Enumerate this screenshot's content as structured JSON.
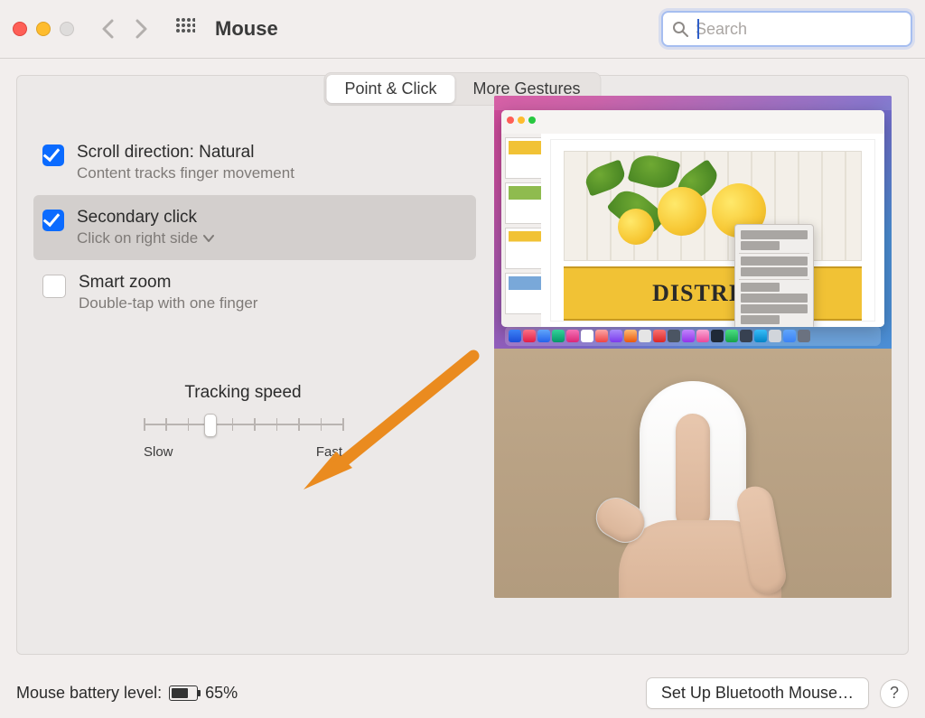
{
  "window": {
    "title": "Mouse",
    "search_placeholder": "Search"
  },
  "tabs": {
    "point_click": "Point & Click",
    "more_gestures": "More Gestures",
    "active": "point_click"
  },
  "options": {
    "scroll": {
      "title": "Scroll direction: Natural",
      "subtitle": "Content tracks finger movement",
      "checked": true
    },
    "secondary": {
      "title": "Secondary click",
      "subtitle": "Click on right side",
      "checked": true,
      "highlighted": true,
      "has_dropdown": true
    },
    "smartzoom": {
      "title": "Smart zoom",
      "subtitle": "Double-tap with one finger",
      "checked": false
    }
  },
  "tracking": {
    "title": "Tracking speed",
    "slow_label": "Slow",
    "fast_label": "Fast",
    "ticks": 10,
    "position_index": 3
  },
  "preview": {
    "banner_text": "DISTRICT"
  },
  "footer": {
    "battery_label": "Mouse battery level:",
    "battery_percent": "65%",
    "setup_button": "Set Up Bluetooth Mouse…",
    "help": "?"
  }
}
